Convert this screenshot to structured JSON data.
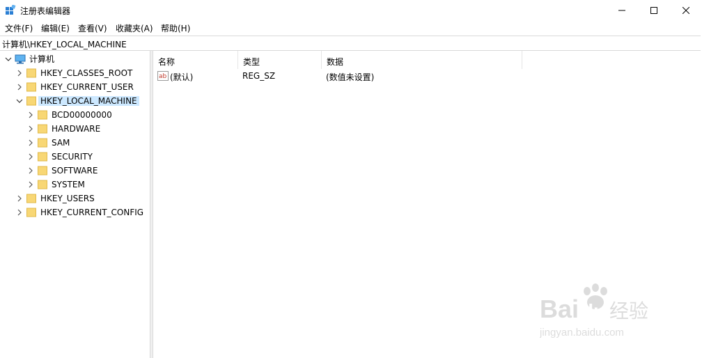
{
  "window": {
    "title": "注册表编辑器",
    "controls": [
      "minimize",
      "maximize",
      "close"
    ]
  },
  "menu": [
    "文件(F)",
    "编辑(E)",
    "查看(V)",
    "收藏夹(A)",
    "帮助(H)"
  ],
  "address": "计算机\\HKEY_LOCAL_MACHINE",
  "tree": {
    "root": "计算机",
    "nodes": [
      {
        "label": "HKEY_CLASSES_ROOT",
        "expanded": false
      },
      {
        "label": "HKEY_CURRENT_USER",
        "expanded": false
      },
      {
        "label": "HKEY_LOCAL_MACHINE",
        "expanded": true,
        "selected": true
      },
      {
        "label": "BCD00000000",
        "child": true
      },
      {
        "label": "HARDWARE",
        "child": true
      },
      {
        "label": "SAM",
        "child": true
      },
      {
        "label": "SECURITY",
        "child": true
      },
      {
        "label": "SOFTWARE",
        "child": true
      },
      {
        "label": "SYSTEM",
        "child": true
      },
      {
        "label": "HKEY_USERS",
        "expanded": false
      },
      {
        "label": "HKEY_CURRENT_CONFIG",
        "expanded": false
      }
    ]
  },
  "list": {
    "columns": [
      "名称",
      "类型",
      "数据"
    ],
    "rows": [
      {
        "name": "(默认)",
        "type": "REG_SZ",
        "data": "(数值未设置)"
      }
    ]
  },
  "watermark": {
    "brand": "Bai",
    "brand2": "du",
    "cn": "经验",
    "url": "jingyan.baidu.com"
  },
  "colors": {
    "selection": "#cce8ff",
    "folder": "#f8d775",
    "accent": "#0078d7"
  }
}
